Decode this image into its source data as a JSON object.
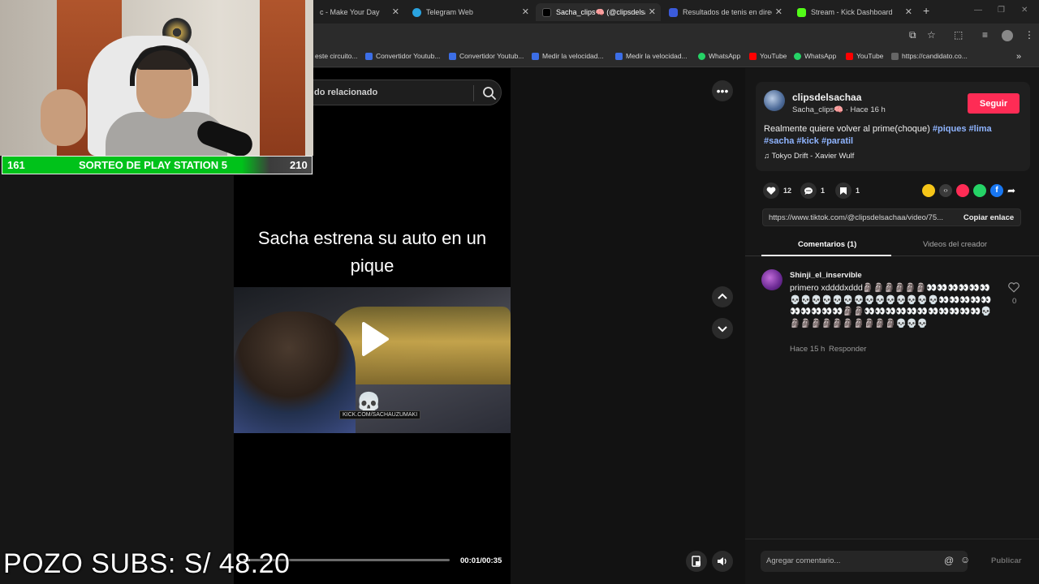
{
  "browser": {
    "tabs": [
      {
        "label": "c - Make Your Day",
        "color": "#555555"
      },
      {
        "label": "Telegram Web",
        "color": "#2aa3e0"
      },
      {
        "label": "Sacha_clips🧠 (@clipsdelsacha",
        "color": "#000000"
      },
      {
        "label": "Resultados de tenis en directo",
        "color": "#3b5bdb"
      },
      {
        "label": "Stream - Kick Dashboard",
        "color": "#53fc18"
      }
    ],
    "new_tab": "+",
    "bookmarks": [
      {
        "label": "este circuito...",
        "color": "#8a8a8a"
      },
      {
        "label": "Convertidor Youtub...",
        "color": "#3c6ee6"
      },
      {
        "label": "Convertidor Youtub...",
        "color": "#3c6ee6"
      },
      {
        "label": "Medir la velocidad...",
        "color": "#3c6ee6"
      },
      {
        "label": "Medir la velocidad...",
        "color": "#3c6ee6"
      },
      {
        "label": "WhatsApp",
        "color": "#25d366"
      },
      {
        "label": "YouTube",
        "color": "#ff0000"
      },
      {
        "label": "WhatsApp",
        "color": "#25d366"
      },
      {
        "label": "YouTube",
        "color": "#ff0000"
      },
      {
        "label": "https://candidato.co...",
        "color": "#666666"
      }
    ]
  },
  "search": {
    "text": "do relacionado"
  },
  "video": {
    "caption_line1": "Sacha estrena su auto en un",
    "caption_line2": "pique",
    "kick_tag": "KICK.COM/SACHAUZUMAKI",
    "skull": "💀",
    "time": "00:01/00:35",
    "progress_fraction": 0.03
  },
  "post": {
    "username": "clipsdelsachaa",
    "nickname": "Sacha_clips🧠",
    "time_ago": "Hace 16 h",
    "follow_label": "Seguir",
    "description_text": "Realmente quiere volver al prime(choque)",
    "hashtags_line1": [
      "#piques",
      "#lima"
    ],
    "hashtags_line2": [
      "#sacha",
      "#kick",
      "#paratil"
    ],
    "music": "Tokyo Drift - Xavier Wulf",
    "likes": "12",
    "comments": "1",
    "saves": "1",
    "link": "https://www.tiktok.com/@clipsdelsachaa/video/75...",
    "copy_label": "Copiar enlace",
    "share_colors": [
      "#f5c518",
      "#3a3a3a",
      "#fe2c55",
      "#25d366",
      "#1877f2"
    ]
  },
  "panel_tabs": {
    "comments": "Comentarios (1)",
    "creator_videos": "Videos del creador"
  },
  "comment": {
    "user": "Shinji_el_inservible",
    "text": "primero xddddxddd🗿🗿🗿🗿🗿🗿👀👀👀👀👀👀💀💀💀💀💀💀💀💀💀💀💀💀💀💀👀👀👀👀👀👀👀👀👀👀🗿🗿👀👀👀👀👀👀👀👀👀👀👀💀🗿🗿🗿🗿🗿🗿🗿🗿🗿🗿💀💀💀",
    "time": "Hace 15 h",
    "reply": "Responder",
    "likes": "0"
  },
  "comment_box": {
    "placeholder": "Agregar comentario...",
    "publish": "Publicar"
  },
  "stream_overlay": {
    "raffle_left": "161",
    "raffle_title": "SORTEO DE PLAY STATION 5",
    "raffle_right": "210",
    "pozo": "POZO SUBS: S/ 48.20"
  }
}
